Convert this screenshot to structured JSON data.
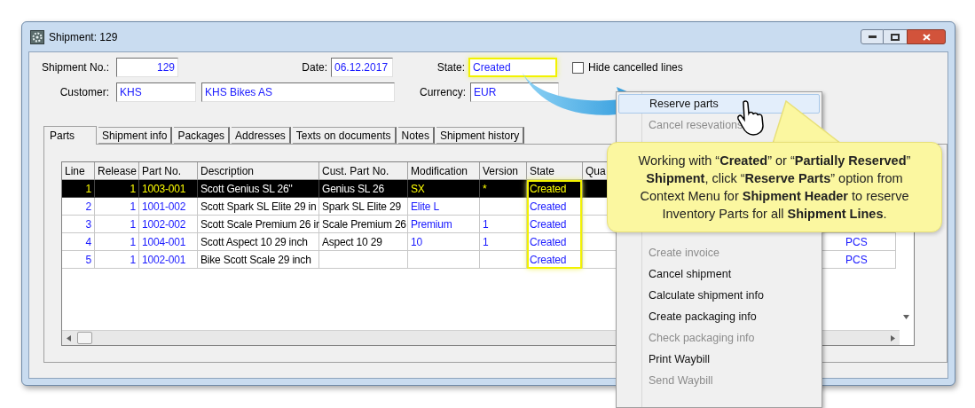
{
  "window": {
    "title": "Shipment: 129"
  },
  "header": {
    "shipment_no": {
      "label": "Shipment No.:",
      "value": "129"
    },
    "date": {
      "label": "Date:",
      "value": "06.12.2017"
    },
    "state": {
      "label": "State:",
      "value": "Created",
      "highlighted": true
    },
    "hide_cancelled": {
      "label": "Hide cancelled lines",
      "checked": false
    },
    "customer": {
      "label": "Customer:",
      "id": "KHS",
      "name": "KHS Bikes AS"
    },
    "currency": {
      "label": "Currency:",
      "value": "EUR"
    }
  },
  "tabs": [
    {
      "label": "Parts",
      "selected": true
    },
    {
      "label": "Shipment info",
      "selected": false
    },
    {
      "label": "Packages",
      "selected": false
    },
    {
      "label": "Addresses",
      "selected": false
    },
    {
      "label": "Texts on documents",
      "selected": false
    },
    {
      "label": "Notes",
      "selected": false
    },
    {
      "label": "Shipment history",
      "selected": false
    }
  ],
  "table": {
    "columns": [
      {
        "label": "Line",
        "kind": "number",
        "highlighted": false
      },
      {
        "label": "Release",
        "kind": "number",
        "highlighted": false
      },
      {
        "label": "Part No.",
        "kind": "value",
        "highlighted": false
      },
      {
        "label": "Description",
        "kind": "text",
        "highlighted": false
      },
      {
        "label": "Cust. Part No.",
        "kind": "text",
        "highlighted": false
      },
      {
        "label": "Modification",
        "kind": "value",
        "highlighted": false
      },
      {
        "label": "Version",
        "kind": "value",
        "highlighted": false
      },
      {
        "label": "State",
        "kind": "value",
        "highlighted": true
      },
      {
        "label": "Qua",
        "kind": "value",
        "highlighted": false
      }
    ],
    "rows": [
      {
        "selected": true,
        "cells": [
          "1",
          "1",
          "1003-001",
          "Scott Genius SL 26''",
          "Genius SL 26",
          "SX",
          "*",
          "Created"
        ]
      },
      {
        "selected": false,
        "cells": [
          "2",
          "1",
          "1001-002",
          "Scott Spark SL Elite 29 in",
          "Spark SL Elite 29",
          "Elite L",
          "",
          "Created"
        ]
      },
      {
        "selected": false,
        "cells": [
          "3",
          "1",
          "1002-002",
          "Scott Scale Premium 26 ir",
          "Scale Premium 26",
          "Premium",
          "1",
          "Created"
        ]
      },
      {
        "selected": false,
        "cells": [
          "4",
          "1",
          "1004-001",
          "Scott Aspect 10 29 inch",
          "Aspect 10 29",
          "10",
          "1",
          "Created"
        ],
        "unit": "PCS"
      },
      {
        "selected": false,
        "cells": [
          "5",
          "1",
          "1002-001",
          "Bike Scott Scale 29 inch",
          "",
          "",
          "",
          "Created"
        ],
        "unit": "PCS"
      }
    ]
  },
  "context_menu": {
    "items": [
      {
        "label": "Reserve parts",
        "disabled": false,
        "selected": true
      },
      {
        "label": "Cancel resevations",
        "disabled": true,
        "selected": false
      },
      {
        "label": "Create invoice",
        "disabled": true,
        "selected": false
      },
      {
        "label": "Cancel shipment",
        "disabled": false,
        "selected": false
      },
      {
        "label": "Calculate shipment info",
        "disabled": false,
        "selected": false
      },
      {
        "label": "Create packaging info",
        "disabled": false,
        "selected": false
      },
      {
        "label": "Check packaging info",
        "disabled": true,
        "selected": false
      },
      {
        "label": "Print Waybill",
        "disabled": false,
        "selected": false
      },
      {
        "label": "Send Waybill",
        "disabled": true,
        "selected": false
      }
    ]
  },
  "callout": {
    "text": "Working with “**Created**” or “**Partially Reserved**” **Shipment**, click “**Reserve Parts**” option from Context Menu for **Shipment Header** to reserve Inventory Parts for all **Shipment Lines**."
  }
}
